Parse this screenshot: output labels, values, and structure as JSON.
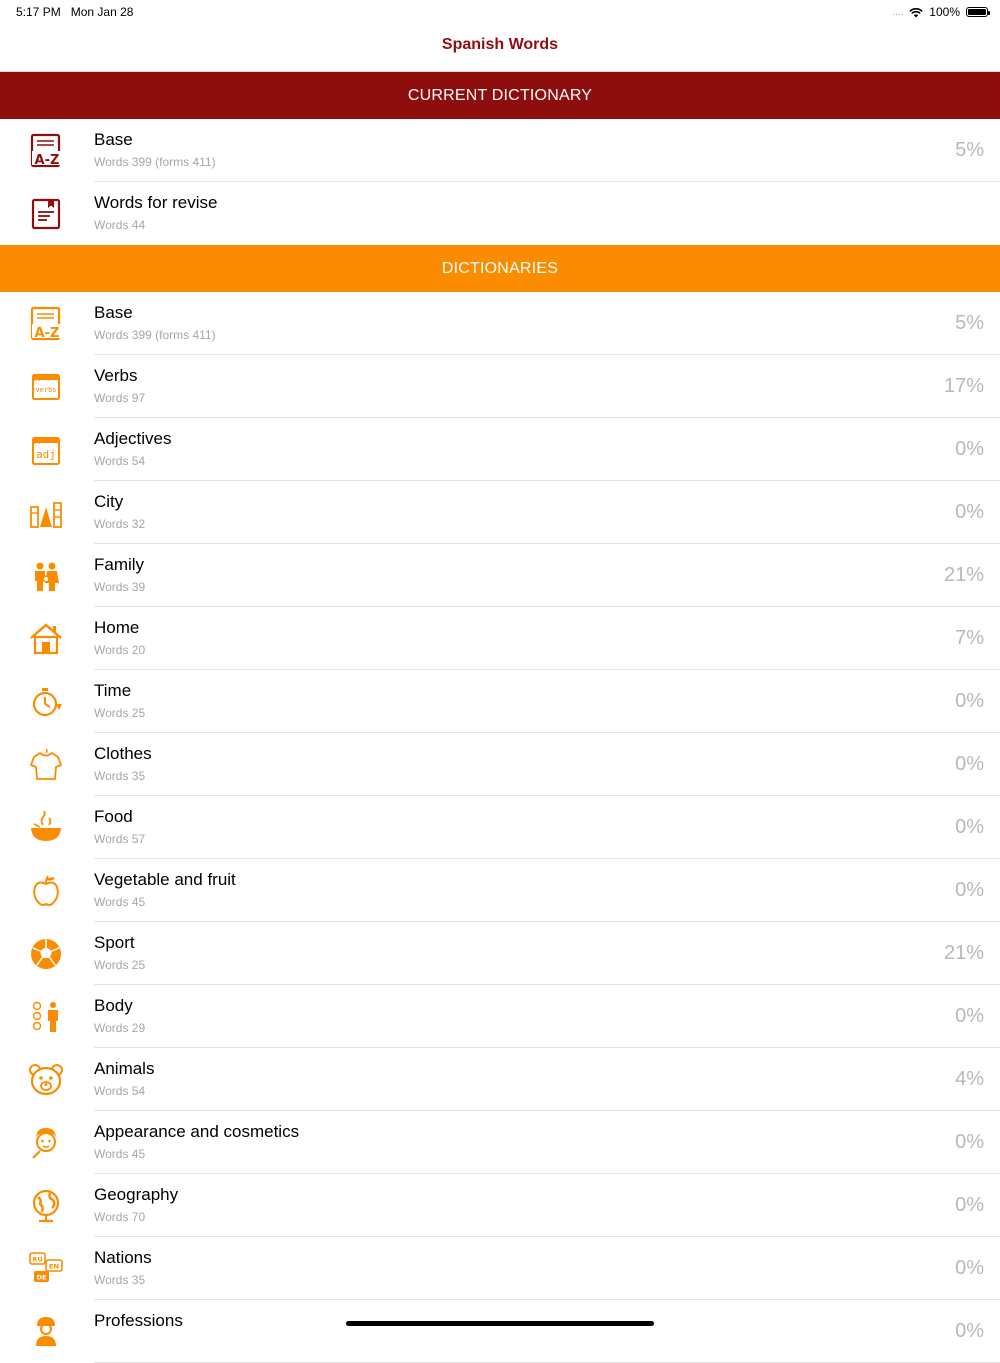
{
  "status": {
    "time": "5:17 PM",
    "date": "Mon Jan 28",
    "battery": "100%",
    "signal": "....",
    "battery_level": 1.0
  },
  "nav": {
    "title": "Spanish Words"
  },
  "sections": {
    "current": "CURRENT DICTIONARY",
    "dictionaries": "DICTIONARIES"
  },
  "colors": {
    "current_accent": "#8e0e0e",
    "dictionaries_accent": "#fb8c00"
  },
  "current": [
    {
      "title": "Base",
      "subtitle": "Words 399 (forms 411)",
      "percent": "5%",
      "icon": "a-z-book-icon"
    },
    {
      "title": "Words for revise",
      "subtitle": "Words 44",
      "percent": "",
      "icon": "bookmark-book-icon"
    }
  ],
  "dictionaries": [
    {
      "title": "Base",
      "subtitle": "Words 399 (forms 411)",
      "percent": "5%",
      "icon": "a-z-book-icon"
    },
    {
      "title": "Verbs",
      "subtitle": "Words 97",
      "percent": "17%",
      "icon": "verbs-icon",
      "icon_text": "verbs"
    },
    {
      "title": "Adjectives",
      "subtitle": "Words 54",
      "percent": "0%",
      "icon": "adjectives-icon",
      "icon_text": "adj"
    },
    {
      "title": "City",
      "subtitle": "Words 32",
      "percent": "0%",
      "icon": "city-icon"
    },
    {
      "title": "Family",
      "subtitle": "Words 39",
      "percent": "21%",
      "icon": "family-icon"
    },
    {
      "title": "Home",
      "subtitle": "Words 20",
      "percent": "7%",
      "icon": "home-icon"
    },
    {
      "title": "Time",
      "subtitle": "Words 25",
      "percent": "0%",
      "icon": "stopwatch-icon"
    },
    {
      "title": "Clothes",
      "subtitle": "Words 35",
      "percent": "0%",
      "icon": "shirt-icon"
    },
    {
      "title": "Food",
      "subtitle": "Words 57",
      "percent": "0%",
      "icon": "bowl-icon"
    },
    {
      "title": "Vegetable and fruit",
      "subtitle": "Words 45",
      "percent": "0%",
      "icon": "apple-icon"
    },
    {
      "title": "Sport",
      "subtitle": "Words 25",
      "percent": "21%",
      "icon": "soccer-ball-icon"
    },
    {
      "title": "Body",
      "subtitle": "Words 29",
      "percent": "0%",
      "icon": "body-icon"
    },
    {
      "title": "Animals",
      "subtitle": "Words 54",
      "percent": "4%",
      "icon": "bear-icon"
    },
    {
      "title": "Appearance and cosmetics",
      "subtitle": "Words 45",
      "percent": "0%",
      "icon": "face-icon"
    },
    {
      "title": "Geography",
      "subtitle": "Words 70",
      "percent": "0%",
      "icon": "globe-icon"
    },
    {
      "title": "Nations",
      "subtitle": "Words 35",
      "percent": "0%",
      "icon": "speech-bubbles-icon"
    },
    {
      "title": "Professions",
      "subtitle": "",
      "percent": "0%",
      "icon": "worker-icon"
    }
  ]
}
